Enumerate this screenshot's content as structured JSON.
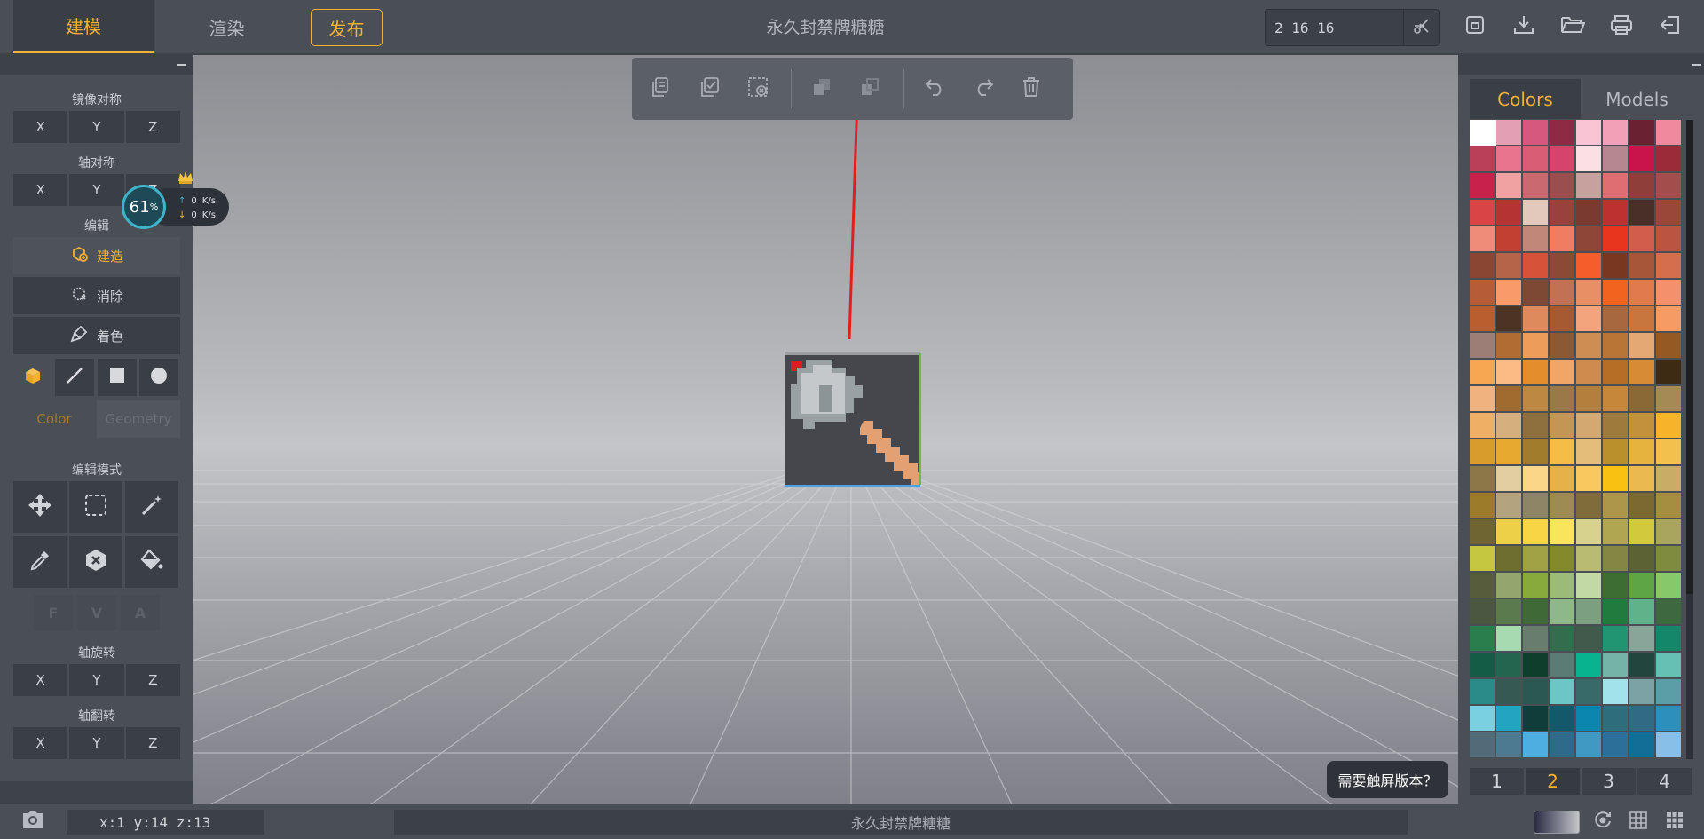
{
  "header": {
    "tabs": [
      {
        "label": "建模"
      },
      {
        "label": "渲染"
      }
    ],
    "publish_label": "发布",
    "title": "永久封禁牌糖糖",
    "coords_value": "2 16 16"
  },
  "left_panel": {
    "mirror_title": "镜像对称",
    "axis_sym_title": "轴对称",
    "edit_title": "编辑",
    "build_label": "建造",
    "erase_label": "消除",
    "paint_label": "着色",
    "color_label": "Color",
    "geometry_label": "Geometry",
    "edit_mode_title": "编辑模式",
    "fva": [
      "F",
      "V",
      "A"
    ],
    "rotate_title": "轴旋转",
    "flip_title": "轴翻转",
    "axes": [
      "X",
      "Y",
      "Z"
    ]
  },
  "speed_widget": {
    "percent": "61",
    "percent_unit": "%",
    "up": "0",
    "down": "0",
    "unit": "K/s"
  },
  "right_panel": {
    "tabs": [
      {
        "label": "Colors"
      },
      {
        "label": "Models"
      }
    ],
    "pages": [
      "1",
      "2",
      "3",
      "4"
    ],
    "active_page": "2",
    "palette": [
      "#ffffff",
      "#e39fb4",
      "#d6587e",
      "#8e2a44",
      "#f9c4d4",
      "#f2a0b7",
      "#6a2233",
      "#f0889e",
      "#b94058",
      "#e9748d",
      "#d85d75",
      "#d6436b",
      "#fbdfe4",
      "#b58891",
      "#c8134b",
      "#9c2b3a",
      "#c8214b",
      "#f0a1a1",
      "#cb6a6e",
      "#9b4f4d",
      "#c6a19e",
      "#de6e71",
      "#8f3e39",
      "#a34d4c",
      "#d94446",
      "#b53433",
      "#e2c9bb",
      "#99413d",
      "#7a3a2f",
      "#bd3230",
      "#4a2f29",
      "#9a4639",
      "#ee8c79",
      "#c24032",
      "#c18778",
      "#f07d62",
      "#8d4637",
      "#e8351e",
      "#d25d4c",
      "#bb5440",
      "#8a4633",
      "#b66449",
      "#d55338",
      "#8b4a35",
      "#f55d2b",
      "#78371e",
      "#a8563a",
      "#d46e4c",
      "#b65d38",
      "#f99a6b",
      "#7d4834",
      "#c27154",
      "#e88f66",
      "#f06420",
      "#e27b4c",
      "#f4906b",
      "#ba5d2f",
      "#4d3324",
      "#de8a5c",
      "#a65a32",
      "#f4a47c",
      "#a7673f",
      "#c8763e",
      "#f49c63",
      "#9c7e76",
      "#b16c34",
      "#ee9c5a",
      "#8b5a35",
      "#ce8e53",
      "#b97535",
      "#e3a873",
      "#955a24",
      "#f7a652",
      "#fcbb84",
      "#e38d2c",
      "#f1a566",
      "#cf8a4d",
      "#b66e27",
      "#d88b35",
      "#3e2b14",
      "#f0b27f",
      "#9f6b2e",
      "#bd8842",
      "#9b7847",
      "#b27f3c",
      "#c7873b",
      "#8b6937",
      "#a58a55",
      "#efb065",
      "#d5b07d",
      "#8e6f3e",
      "#c49655",
      "#d3a971",
      "#9c7b3c",
      "#c2913c",
      "#f7b42a",
      "#d89c2c",
      "#e6aa31",
      "#a17c2c",
      "#f6bd46",
      "#e4bd7a",
      "#b9902c",
      "#e6b33c",
      "#f3bf4d",
      "#8d7647",
      "#e2cfa1",
      "#fbd688",
      "#e5b24a",
      "#f9c85f",
      "#f9c212",
      "#eab94f",
      "#c9ac66",
      "#9c7b2a",
      "#b3a37e",
      "#8e8566",
      "#9e8b52",
      "#7f6c3a",
      "#ad9649",
      "#7b6a2f",
      "#a58e3f",
      "#6e6533",
      "#eed048",
      "#f7d545",
      "#f9e55b",
      "#d7d28e",
      "#b0a550",
      "#d3c93c",
      "#a9a55e",
      "#c5c740",
      "#6e6e2e",
      "#a1a245",
      "#828a2c",
      "#b9bb72",
      "#848644",
      "#5c6234",
      "#7f8b3f",
      "#575c3c",
      "#94a56d",
      "#88aa3c",
      "#9dbb78",
      "#c2d9a4",
      "#3e6d34",
      "#5ea545",
      "#86c86a",
      "#4b5741",
      "#5b7a4d",
      "#3f6a38",
      "#8fb88a",
      "#7c9f82",
      "#1f7c3e",
      "#5fb28a",
      "#3d6840",
      "#2a7d4d",
      "#a8dab2",
      "#687d6c",
      "#326e4e",
      "#415a4b",
      "#219472",
      "#89a59a",
      "#14866a",
      "#145c46",
      "#23664f",
      "#0e3f2c",
      "#5a7c74",
      "#08b490",
      "#75b3a6",
      "#22453e",
      "#66c0b3",
      "#2b8b89",
      "#365953",
      "#2b5951",
      "#6dc6c6",
      "#386a6a",
      "#a1e2eb",
      "#7ca2a6",
      "#5c9ea8",
      "#7ad0e1",
      "#22a5c0",
      "#0e3d3a",
      "#13586b",
      "#0b86ae",
      "#2e6d7b",
      "#2f6b84",
      "#2d8fbc",
      "#516b78",
      "#4e7a91",
      "#4eaee1",
      "#2e6a8a",
      "#4099c2",
      "#2c6f99",
      "#116e96",
      "#88bfe9"
    ]
  },
  "tooltip": "需要触屏版本？",
  "status": {
    "coords": "x:1 y:14 z:13",
    "title": "永久封禁牌糖糖"
  },
  "colors": {
    "accent": "#f4b132",
    "panel": "#4a4e55",
    "button": "#3a3e45"
  },
  "icons": [
    "copy-icon",
    "select-all-icon",
    "deselect-icon",
    "union-icon",
    "subtract-icon",
    "undo-icon",
    "redo-icon",
    "trash-icon",
    "save-icon",
    "download-icon",
    "folder-open-icon",
    "print-icon",
    "exit-icon",
    "scissors-icon",
    "camera-icon",
    "move-icon",
    "marquee-icon",
    "magic-wand-icon",
    "eyedropper-icon",
    "delete-hex-icon",
    "paint-bucket-icon",
    "cube-icon",
    "line-icon",
    "square-icon",
    "circle-icon",
    "orbit-icon",
    "grid-icon",
    "grid-fine-icon"
  ]
}
